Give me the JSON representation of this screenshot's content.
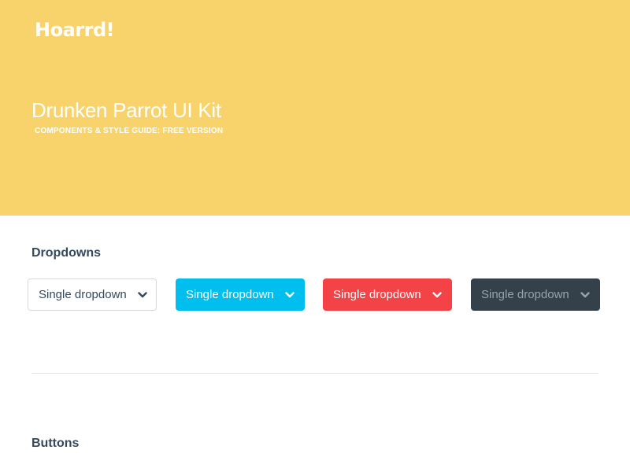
{
  "hero": {
    "logo": "Hoarrd!",
    "title": "Drunken Parrot UI Kit",
    "subtitle": "COMPONENTS & STYLE GUIDE: FREE VERSION",
    "background_color": "#f8d36c"
  },
  "sections": {
    "dropdowns": {
      "heading": "Dropdowns",
      "items": [
        {
          "label": "Single dropdown",
          "style": "white",
          "icon": "chevron-down-icon"
        },
        {
          "label": "Single dropdown",
          "style": "blue",
          "color": "#00bfef",
          "icon": "chevron-down-icon"
        },
        {
          "label": "Single dropdown",
          "style": "red",
          "color": "#f34347",
          "icon": "chevron-down-icon"
        },
        {
          "label": "Single dropdown",
          "style": "dark",
          "color": "#34414a",
          "icon": "chevron-down-icon"
        }
      ]
    },
    "buttons": {
      "heading": "Buttons"
    }
  }
}
